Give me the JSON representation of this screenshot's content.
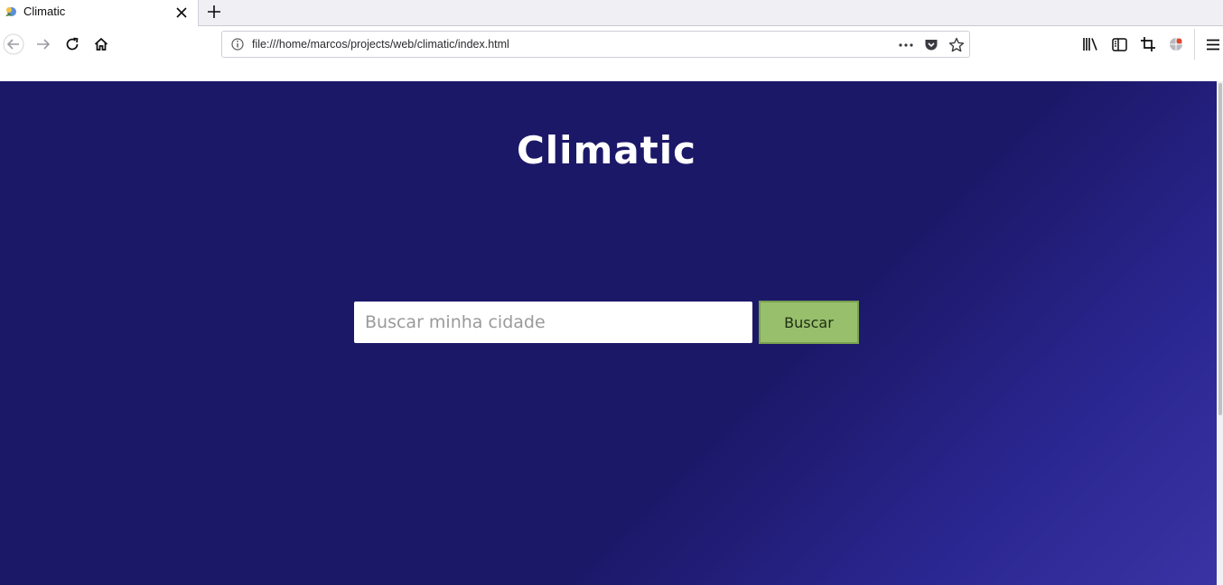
{
  "browser": {
    "tab": {
      "title": "Climatic",
      "favicon": "climatic-favicon",
      "close_icon": "close-icon"
    },
    "new_tab_icon": "plus-icon",
    "nav": {
      "back_icon": "back-arrow-icon",
      "forward_icon": "forward-arrow-icon",
      "reload_icon": "reload-icon",
      "home_icon": "home-icon"
    },
    "url": "file:///home/marcos/projects/web/climatic/index.html",
    "url_actions": [
      "more-actions-icon",
      "pocket-icon",
      "bookmark-star-icon"
    ],
    "toolbar": [
      "library-icon",
      "sidebar-icon",
      "screenshot-crop-icon",
      "extension-globe-icon",
      "hamburger-menu-icon"
    ]
  },
  "page": {
    "title": "Climatic",
    "search": {
      "placeholder": "Buscar minha cidade",
      "value": ""
    },
    "search_button_label": "Buscar",
    "colors": {
      "background": "#1c1868",
      "button": "#98bf6c",
      "title": "#ffffff"
    }
  }
}
